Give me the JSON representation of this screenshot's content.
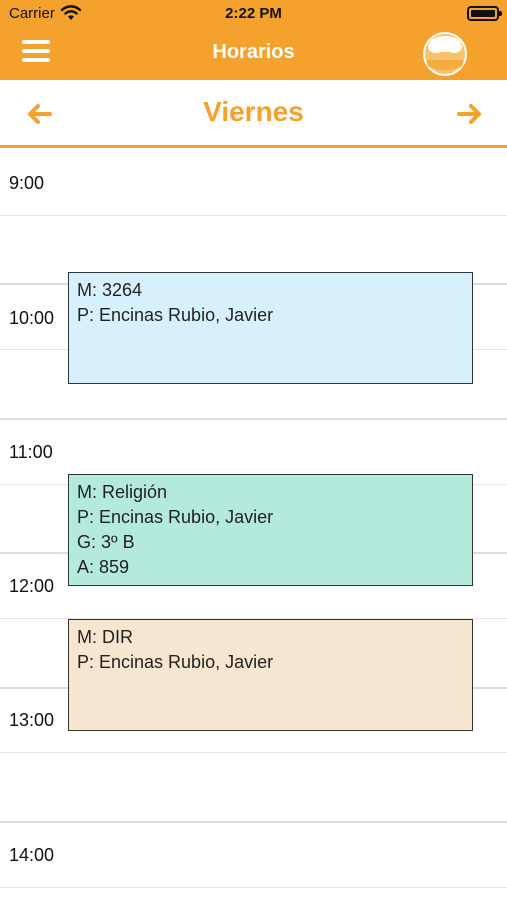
{
  "status_bar": {
    "carrier": "Carrier",
    "time": "2:22 PM"
  },
  "nav": {
    "title": "Horarios",
    "menu_icon": "hamburger-menu-icon",
    "logo_icon": "ghc-app-logo"
  },
  "day": {
    "title": "Viernes"
  },
  "hours": [
    "9:00",
    "10:00",
    "11:00",
    "12:00",
    "13:00",
    "14:00"
  ],
  "events": [
    {
      "lines": [
        "M: 3264",
        "P: Encinas Rubio, Javier"
      ],
      "color": "#d6f1fb"
    },
    {
      "lines": [
        "M: Religión",
        "P: Encinas Rubio, Javier",
        "G: 3º B",
        "A: 859"
      ],
      "color": "#b4eadb"
    },
    {
      "lines": [
        "M: DIR",
        "P: Encinas Rubio, Javier"
      ],
      "color": "#f7e6cf"
    }
  ],
  "colors": {
    "accent": "#f4a22d"
  }
}
